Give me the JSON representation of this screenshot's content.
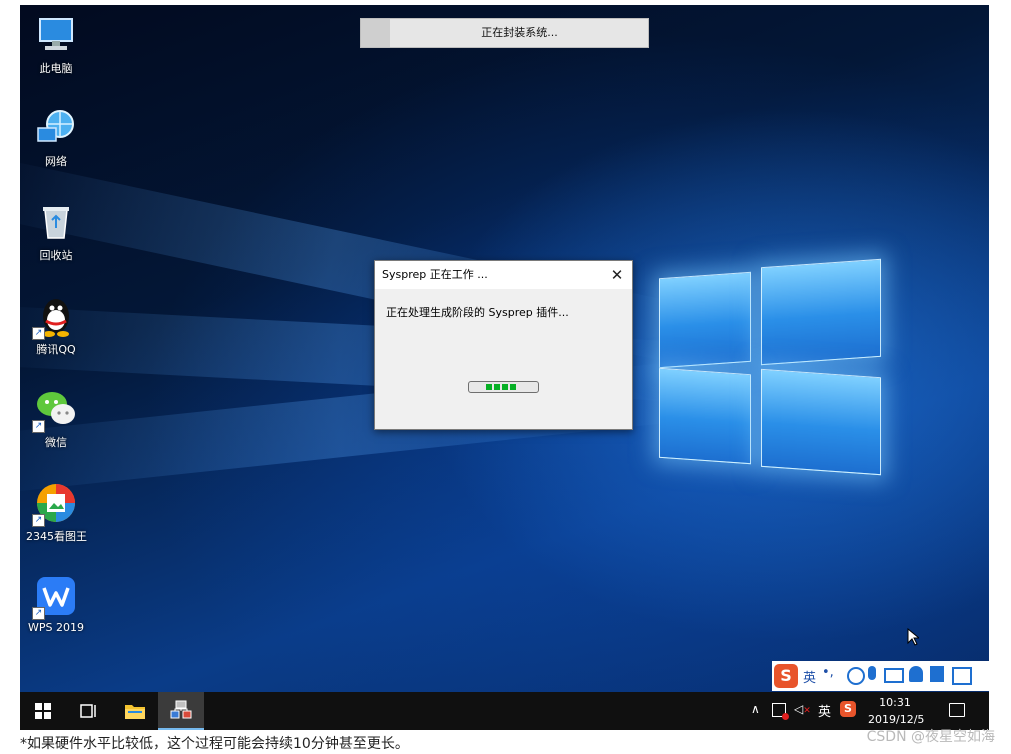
{
  "desktop": {
    "icons": [
      {
        "label": "此电脑",
        "icon": "computer-icon"
      },
      {
        "label": "网络",
        "icon": "network-icon"
      },
      {
        "label": "回收站",
        "icon": "recycle-bin-icon"
      },
      {
        "label": "腾讯QQ",
        "icon": "qq-icon"
      },
      {
        "label": "微信",
        "icon": "wechat-icon"
      },
      {
        "label": "2345看图王",
        "icon": "image-viewer-icon"
      },
      {
        "label": "WPS 2019",
        "icon": "wps-icon"
      }
    ]
  },
  "banner": {
    "text": "正在封装系统..."
  },
  "dialog": {
    "title": "Sysprep 正在工作 ...",
    "close": "✕",
    "message": "正在处理生成阶段的 Sysprep 插件..."
  },
  "ime": {
    "brand": "S",
    "lang": "英",
    "punct": "•,"
  },
  "taskbar": {
    "tray_lang": "英",
    "time": "10:31",
    "date": "2019/12/5",
    "chevron": "∧"
  },
  "caption": "*如果硬件水平比较低，这个过程可能会持续10分钟甚至更长。",
  "watermark": "CSDN @夜星空如海",
  "colors": {
    "accent": "#06b025",
    "taskbar": "#101010",
    "desktop": "#0a3c88"
  }
}
